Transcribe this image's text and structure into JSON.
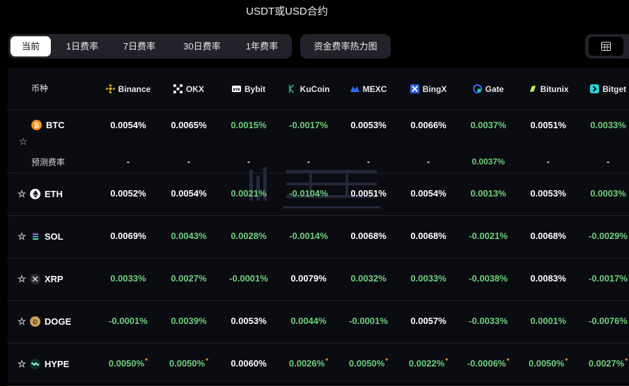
{
  "title": "USDT或USD合约",
  "tabs": [
    {
      "label": "当前",
      "active": true
    },
    {
      "label": "1日费率",
      "active": false
    },
    {
      "label": "7日费率",
      "active": false
    },
    {
      "label": "30日费率",
      "active": false
    },
    {
      "label": "1年费率",
      "active": false
    }
  ],
  "heatmap_button": "资金费率热力图",
  "calendar_icon": "calendar-icon",
  "colors": {
    "positive": "#6fcf7f",
    "neutral": "#ffffff",
    "asterisk": "#f0a13c",
    "background": "#0b0c11"
  },
  "table": {
    "coin_header": "币种",
    "exchanges": [
      {
        "name": "Binance",
        "icon": "binance-icon",
        "color": "#f0b90b"
      },
      {
        "name": "OKX",
        "icon": "okx-icon",
        "color": "#ffffff"
      },
      {
        "name": "Bybit",
        "icon": "bybit-icon",
        "color": "#ffffff"
      },
      {
        "name": "KuCoin",
        "icon": "kucoin-icon",
        "color": "#1ea97c"
      },
      {
        "name": "MEXC",
        "icon": "mexc-icon",
        "color": "#2e6bf6"
      },
      {
        "name": "BingX",
        "icon": "bingx-icon",
        "color": "#2a5ee8"
      },
      {
        "name": "Gate",
        "icon": "gate-icon",
        "color": "#2e6bf6"
      },
      {
        "name": "Bitunix",
        "icon": "bitunix-icon",
        "color": "#b7f34b"
      },
      {
        "name": "Bitget",
        "icon": "bitget-icon",
        "color": "#2fd1d8"
      }
    ],
    "predicted_label": "预测费率",
    "rows": [
      {
        "coin": "BTC",
        "icon": "btc-icon",
        "values": [
          {
            "v": "0.0054%",
            "c": "w"
          },
          {
            "v": "0.0065%",
            "c": "w"
          },
          {
            "v": "0.0015%",
            "c": "g"
          },
          {
            "v": "-0.0017%",
            "c": "g"
          },
          {
            "v": "0.0053%",
            "c": "w"
          },
          {
            "v": "0.0066%",
            "c": "w"
          },
          {
            "v": "0.0037%",
            "c": "g"
          },
          {
            "v": "0.0051%",
            "c": "w"
          },
          {
            "v": "0.0033%",
            "c": "g"
          }
        ],
        "predicted": [
          {
            "v": "-",
            "c": "w"
          },
          {
            "v": "-",
            "c": "w"
          },
          {
            "v": "-",
            "c": "w"
          },
          {
            "v": "-",
            "c": "w"
          },
          {
            "v": "-",
            "c": "w"
          },
          {
            "v": "-",
            "c": "w"
          },
          {
            "v": "0.0037%",
            "c": "g"
          },
          {
            "v": "-",
            "c": "w"
          },
          {
            "v": "-",
            "c": "w"
          }
        ]
      },
      {
        "coin": "ETH",
        "icon": "eth-icon",
        "values": [
          {
            "v": "0.0052%",
            "c": "w"
          },
          {
            "v": "0.0054%",
            "c": "w"
          },
          {
            "v": "0.0021%",
            "c": "g"
          },
          {
            "v": "-0.0104%",
            "c": "g"
          },
          {
            "v": "0.0051%",
            "c": "w"
          },
          {
            "v": "0.0054%",
            "c": "w"
          },
          {
            "v": "0.0013%",
            "c": "g"
          },
          {
            "v": "0.0053%",
            "c": "w"
          },
          {
            "v": "0.0003%",
            "c": "g"
          }
        ]
      },
      {
        "coin": "SOL",
        "icon": "sol-icon",
        "values": [
          {
            "v": "0.0069%",
            "c": "w"
          },
          {
            "v": "0.0043%",
            "c": "g"
          },
          {
            "v": "0.0028%",
            "c": "g"
          },
          {
            "v": "-0.0014%",
            "c": "g"
          },
          {
            "v": "0.0068%",
            "c": "w"
          },
          {
            "v": "0.0068%",
            "c": "w"
          },
          {
            "v": "-0.0021%",
            "c": "g"
          },
          {
            "v": "0.0068%",
            "c": "w"
          },
          {
            "v": "-0.0029%",
            "c": "g"
          }
        ]
      },
      {
        "coin": "XRP",
        "icon": "xrp-icon",
        "values": [
          {
            "v": "0.0033%",
            "c": "g"
          },
          {
            "v": "0.0027%",
            "c": "g"
          },
          {
            "v": "-0.0001%",
            "c": "g"
          },
          {
            "v": "0.0079%",
            "c": "w"
          },
          {
            "v": "0.0032%",
            "c": "g"
          },
          {
            "v": "0.0033%",
            "c": "g"
          },
          {
            "v": "-0.0038%",
            "c": "g"
          },
          {
            "v": "0.0083%",
            "c": "w"
          },
          {
            "v": "-0.0017%",
            "c": "g"
          }
        ]
      },
      {
        "coin": "DOGE",
        "icon": "doge-icon",
        "values": [
          {
            "v": "-0.0001%",
            "c": "g"
          },
          {
            "v": "0.0039%",
            "c": "g"
          },
          {
            "v": "0.0053%",
            "c": "w"
          },
          {
            "v": "0.0044%",
            "c": "g"
          },
          {
            "v": "-0.0001%",
            "c": "g"
          },
          {
            "v": "0.0057%",
            "c": "w"
          },
          {
            "v": "-0.0033%",
            "c": "g"
          },
          {
            "v": "0.0001%",
            "c": "g"
          },
          {
            "v": "-0.0076%",
            "c": "g"
          }
        ]
      },
      {
        "coin": "HYPE",
        "icon": "hype-icon",
        "values": [
          {
            "v": "0.0050%",
            "c": "g",
            "a": "*"
          },
          {
            "v": "0.0050%",
            "c": "g",
            "a": "*"
          },
          {
            "v": "0.0060%",
            "c": "w"
          },
          {
            "v": "0.0026%",
            "c": "g",
            "a": "*"
          },
          {
            "v": "0.0050%",
            "c": "g",
            "a": "*"
          },
          {
            "v": "0.0022%",
            "c": "g",
            "a": "*"
          },
          {
            "v": "-0.0006%",
            "c": "g",
            "a": "*"
          },
          {
            "v": "0.0050%",
            "c": "g",
            "a": "*"
          },
          {
            "v": "0.0027%",
            "c": "g",
            "a": "*"
          }
        ]
      }
    ]
  }
}
